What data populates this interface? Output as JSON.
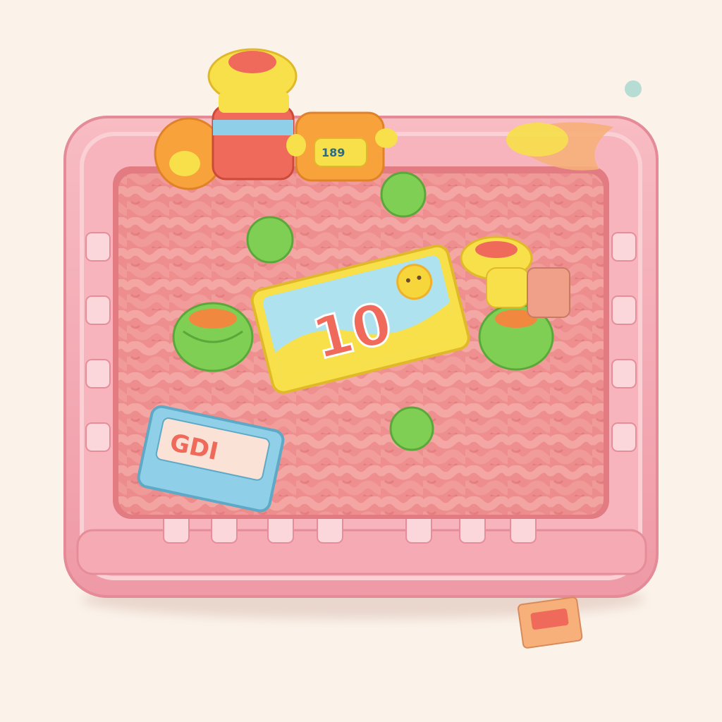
{
  "scene": {
    "subject": "pink-plastic-tray-with-toy-figures",
    "colors": {
      "background": "#fbf3ea",
      "tray": "#f4a7b1",
      "tray_dark": "#e98996",
      "tray_light": "#fbd3d8",
      "filling": "#f08c8c",
      "filling_dark": "#d9676c",
      "yellow": "#f7e04a",
      "orange": "#f7a23a",
      "red": "#ef6a5a",
      "green": "#7fcf54",
      "blue": "#8fd0e8"
    }
  },
  "labels": {
    "card_text": "10",
    "box_text": "GDI",
    "robot_text": "189"
  }
}
